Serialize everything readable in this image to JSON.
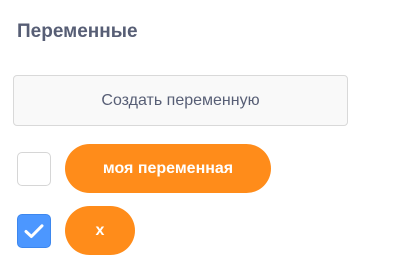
{
  "panel": {
    "title": "Переменные",
    "create_button_label": "Создать переменную",
    "variables": [
      {
        "name": "моя переменная",
        "checked": false
      },
      {
        "name": "x",
        "checked": true
      }
    ]
  },
  "colors": {
    "title_text": "#575e75",
    "variable_pill": "#ff8c1a",
    "checkbox_checked": "#4c97ff",
    "checkbox_border": "#d6d6d6"
  },
  "icons": {
    "checkmark": "checkmark-icon"
  }
}
